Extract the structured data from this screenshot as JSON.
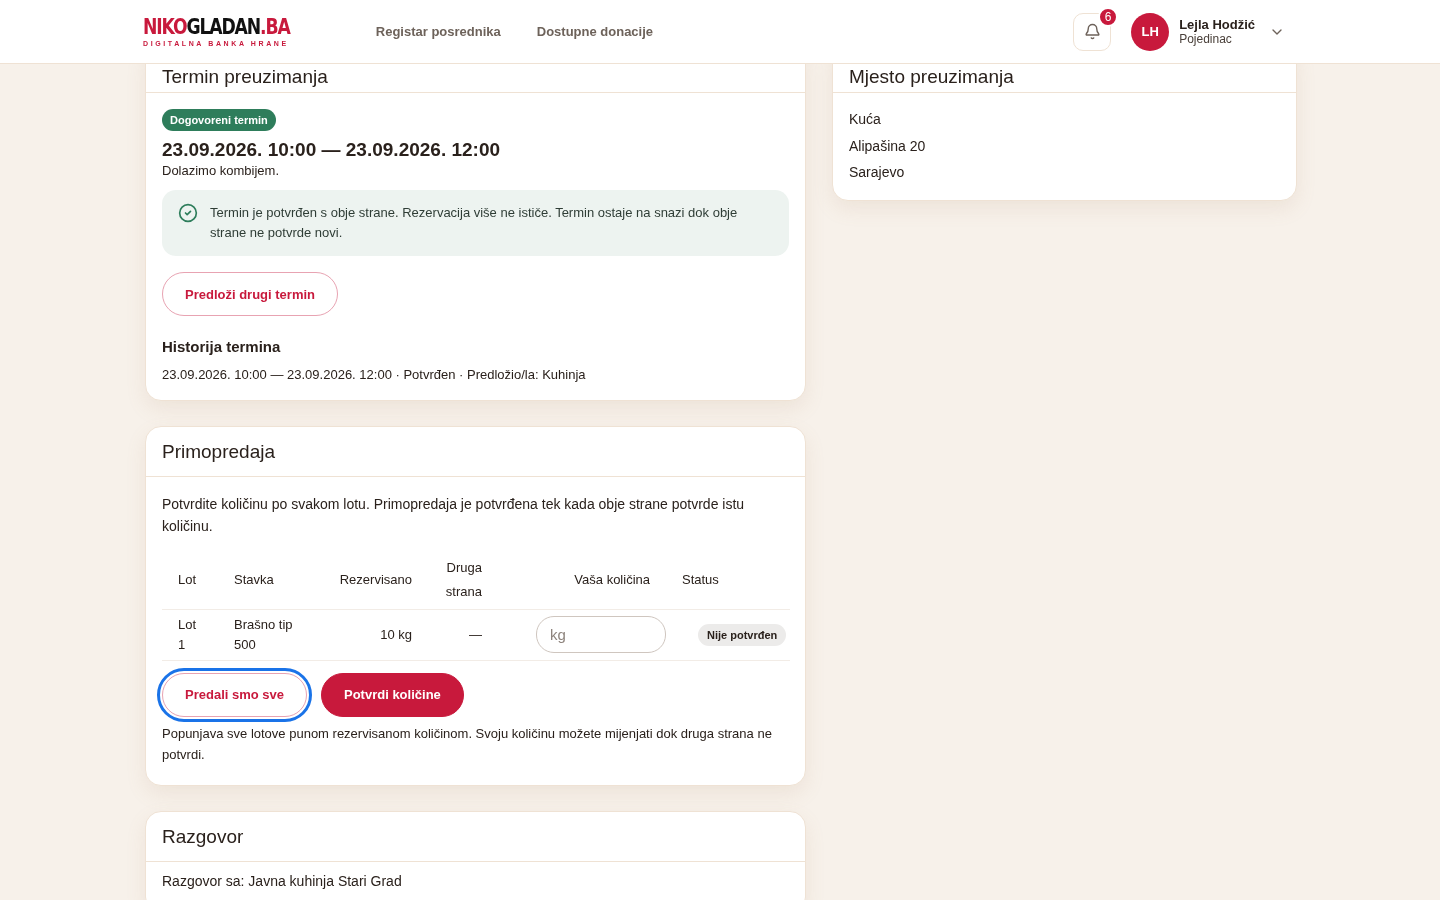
{
  "header": {
    "logo": {
      "accent": "NIKO",
      "main": "GLADAN",
      "suffix": ".BA",
      "tagline": "DIGITALNA BANKA HRANE"
    },
    "nav": [
      {
        "label": "Registar posrednika"
      },
      {
        "label": "Dostupne donacije"
      }
    ],
    "notifications": {
      "count": "6"
    },
    "user": {
      "initials": "LH",
      "name": "Lejla Hodžić",
      "role": "Pojedinac"
    }
  },
  "schedule": {
    "title": "Termin preuzimanja",
    "badge": "Dogovoreni termin",
    "range": "23.09.2026. 10:00 — 23.09.2026. 12:00",
    "note": "Dolazimo kombijem.",
    "info": "Termin je potvrđen s obje strane. Rezervacija više ne ističe. Termin ostaje na snazi dok obje strane ne potvrde novi.",
    "propose_button": "Predloži drugi termin",
    "history_title": "Historija termina",
    "history": [
      "23.09.2026. 10:00 — 23.09.2026. 12:00 · Potvrđen · Predložio/la: Kuhinja"
    ]
  },
  "location": {
    "title": "Mjesto preuzimanja",
    "lines": [
      "Kuća",
      "Alipašina 20",
      "Sarajevo"
    ]
  },
  "handover": {
    "title": "Primopredaja",
    "intro": "Potvrdite količinu po svakom lotu. Primopredaja je potvrđena tek kada obje strane potvrde istu količinu.",
    "columns": [
      "Lot",
      "Stavka",
      "Rezervisano",
      "Druga strana",
      "Vaša količina",
      "Status"
    ],
    "rows": [
      {
        "lot": "Lot 1",
        "item": "Brašno tip 500",
        "reserved": "10 kg",
        "other": "—",
        "quantity_placeholder": "kg",
        "status": "Nije potvrđen"
      }
    ],
    "buttons": [
      {
        "label": "Predali smo sve",
        "kind": "outline",
        "focused": true
      },
      {
        "label": "Potvrdi količine",
        "kind": "primary",
        "focused": false
      }
    ],
    "hint": "Popunjava sve lotove punom rezervisanom količinom. Svoju količinu možete mijenjati dok druga strana ne potvrdi."
  },
  "conversation": {
    "title": "Razgovor",
    "with": "Razgovor sa: Javna kuhinja Stari Grad"
  }
}
